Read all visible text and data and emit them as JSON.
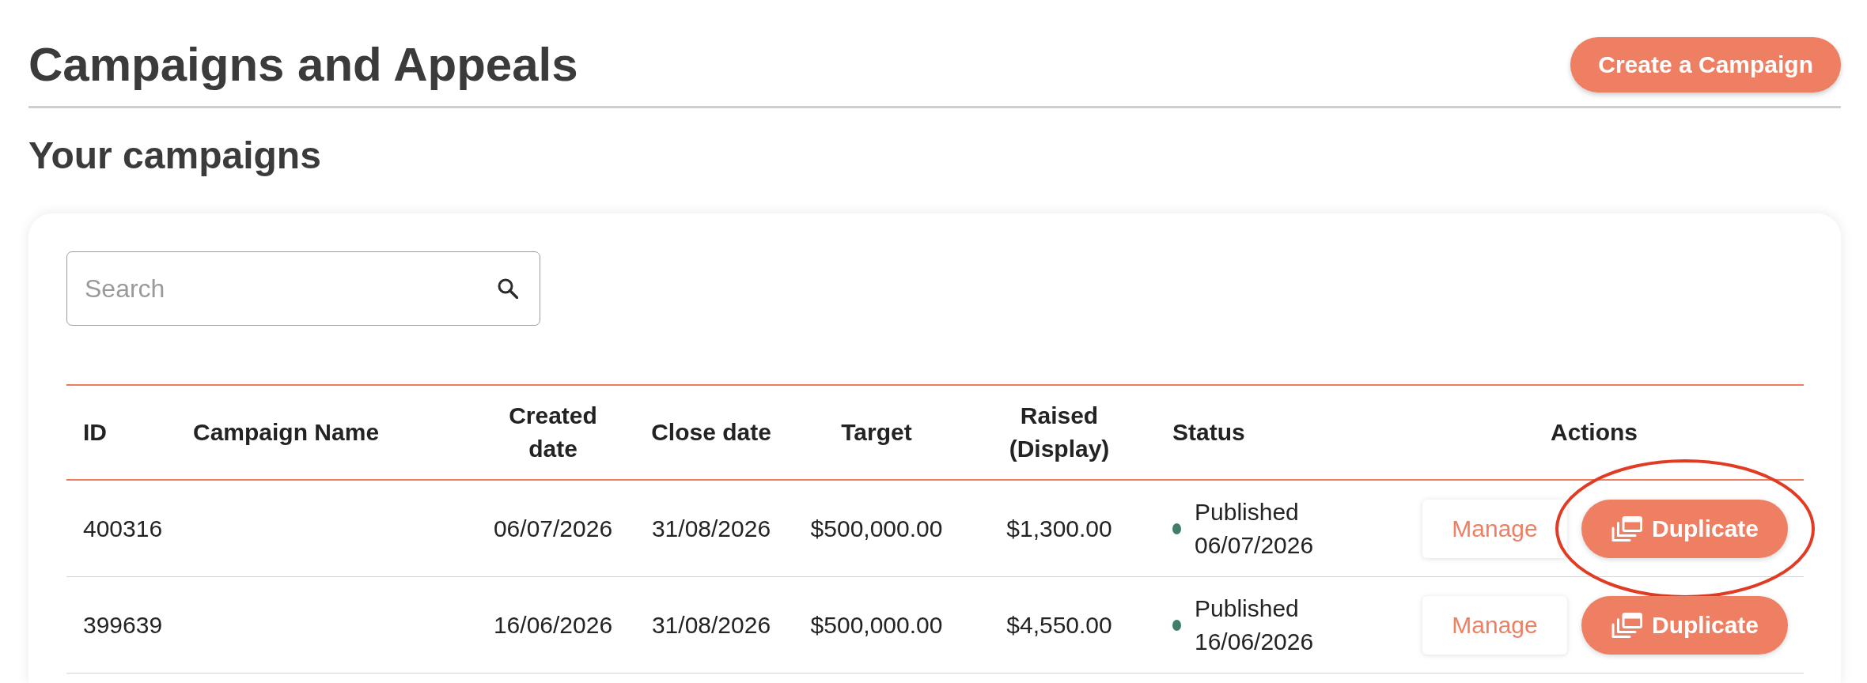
{
  "page": {
    "title": "Campaigns and Appeals",
    "create_button": "Create a Campaign"
  },
  "section": {
    "title": "Your campaigns"
  },
  "search": {
    "placeholder": "Search"
  },
  "table": {
    "columns": [
      "ID",
      "Campaign Name",
      "Created date",
      "Close date",
      "Target",
      "Raised (Display)",
      "Status",
      "Actions"
    ],
    "rows": [
      {
        "id": "400316",
        "created": "06/07/2026",
        "close_date": "31/08/2026",
        "target": "$500,000.00",
        "raised": "$1,300.00",
        "status": "Published",
        "status_date": "06/07/2026",
        "actions": [
          {
            "kind": "plain",
            "label": "Manage",
            "highlighted": false
          },
          {
            "kind": "copy",
            "label": "Duplicate",
            "highlighted": true
          }
        ]
      },
      {
        "id": "399639",
        "created": "16/06/2026",
        "close_date": "31/08/2026",
        "target": "$500,000.00",
        "raised": "$4,550.00",
        "status": "Published",
        "status_date": "16/06/2026",
        "actions": [
          {
            "kind": "plain",
            "label": "Manage",
            "highlighted": false
          },
          {
            "kind": "copy",
            "label": "Duplicate",
            "highlighted": false
          }
        ]
      }
    ]
  }
}
